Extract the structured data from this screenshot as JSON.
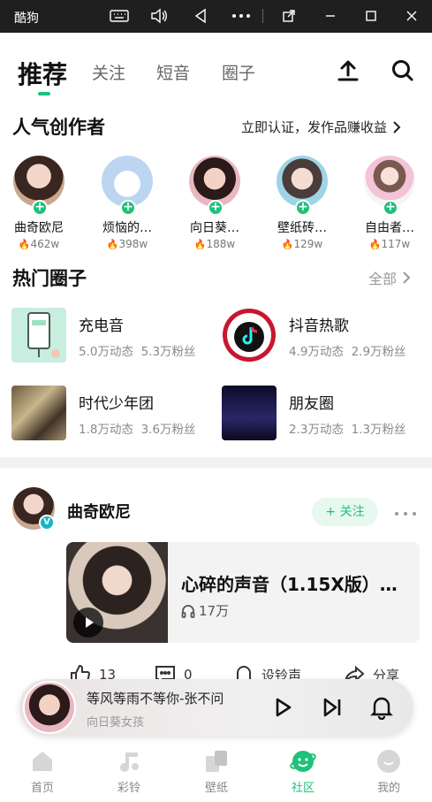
{
  "titlebar": {
    "app": "酷狗"
  },
  "nav": {
    "active_tab": "推荐",
    "tabs": [
      "关注",
      "短音",
      "圈子"
    ]
  },
  "creators_section": {
    "title": "人气创作者",
    "link": "立即认证，发作品赚收益",
    "items": [
      {
        "name": "曲奇欧尼",
        "fans": "462w"
      },
      {
        "name": "烦恼的…",
        "fans": "398w"
      },
      {
        "name": "向日葵…",
        "fans": "188w"
      },
      {
        "name": "壁纸砖…",
        "fans": "129w"
      },
      {
        "name": "自由者…",
        "fans": "117w"
      }
    ]
  },
  "circles_section": {
    "title": "热门圈子",
    "link": "全部",
    "items": [
      {
        "name": "充电音",
        "posts": "5.0万动态",
        "fans": "5.3万粉丝"
      },
      {
        "name": "抖音热歌",
        "posts": "4.9万动态",
        "fans": "2.9万粉丝"
      },
      {
        "name": "时代少年团",
        "posts": "1.8万动态",
        "fans": "3.6万粉丝"
      },
      {
        "name": "朋友圈",
        "posts": "2.3万动态",
        "fans": "1.3万粉丝"
      }
    ]
  },
  "post": {
    "author": "曲奇欧尼",
    "badge": "V",
    "follow_label": "+ 关注",
    "song_title": "心碎的声音（1.15X版）…",
    "plays": "17万",
    "actions": {
      "like": "13",
      "comment": "0",
      "ringtone": "设铃声",
      "share": "分享"
    }
  },
  "player": {
    "title": "等风等雨不等你-张不问",
    "artist": "向日葵女孩"
  },
  "tabbar": {
    "items": [
      "首页",
      "彩铃",
      "壁纸",
      "社区",
      "我的"
    ],
    "active": "社区"
  },
  "colors": {
    "accent": "#1ec27b",
    "fire": "#e9473e"
  }
}
